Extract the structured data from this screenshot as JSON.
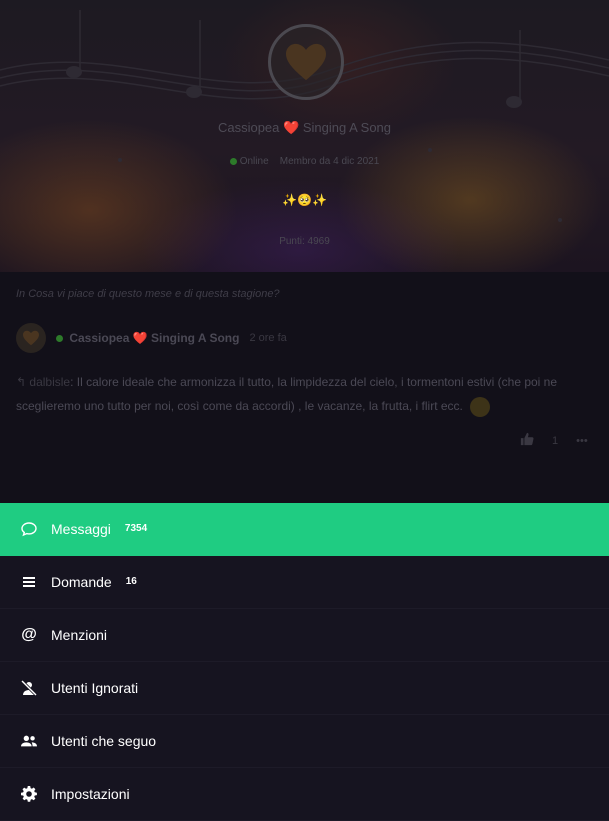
{
  "profile": {
    "name": "Cassiopea",
    "name_heart": "❤️",
    "name_suffix": "Singing A Song",
    "status": "Online",
    "member_since": "Membro da 4 dic 2021",
    "bio_emoji": "✨🥺✨",
    "points": "Punti: 4969"
  },
  "post": {
    "question": "In Cosa vi piace di questo mese e di questa stagione?",
    "author": "Cassiopea",
    "author_heart": "❤️",
    "author_suffix": "Singing A Song",
    "time": "2 ore fa",
    "reply_to": "dalbisle",
    "text": "Il calore ideale che armonizza il tutto, la limpidezza del cielo, i tormentoni estivi (che poi ne sceglieremo uno tutto per noi, così come da accordi) , le vacanze, la frutta, i flirt ecc.",
    "likes": "1"
  },
  "menu": {
    "items": [
      {
        "label": "Messaggi",
        "count": "7354",
        "icon": "chat-bubble-icon",
        "active": true
      },
      {
        "label": "Domande",
        "count": "16",
        "icon": "list-icon",
        "active": false
      },
      {
        "label": "Menzioni",
        "count": "",
        "icon": "at-icon",
        "active": false
      },
      {
        "label": "Utenti Ignorati",
        "count": "",
        "icon": "user-slash-icon",
        "active": false
      },
      {
        "label": "Utenti che seguo",
        "count": "",
        "icon": "users-icon",
        "active": false
      },
      {
        "label": "Impostazioni",
        "count": "",
        "icon": "gear-icon",
        "active": false
      }
    ]
  },
  "colors": {
    "accent": "#1fcc82",
    "menu_bg": "#161420",
    "page_bg": "#121019"
  }
}
